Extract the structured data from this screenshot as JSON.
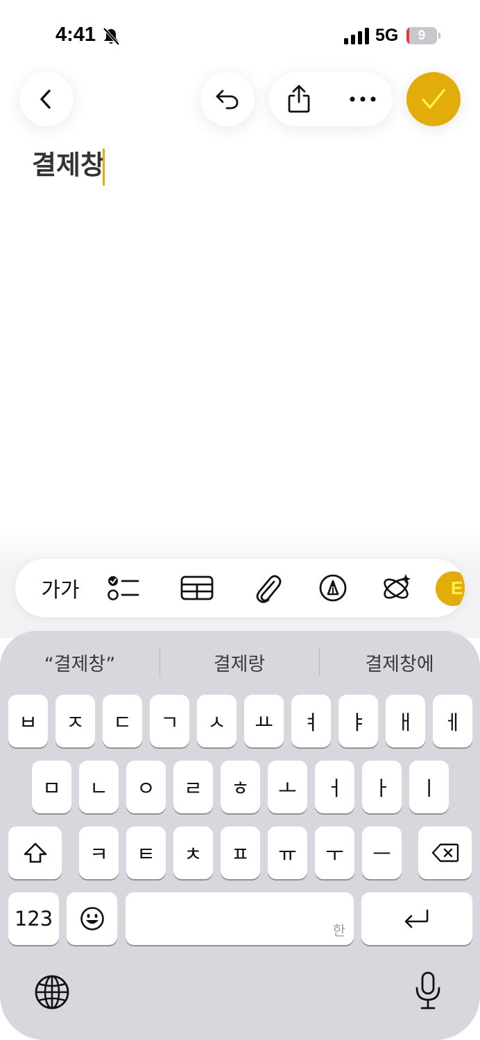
{
  "status_bar": {
    "time": "4:41",
    "network": "5G",
    "battery": "9",
    "battery_level": 0.09
  },
  "toolbar": {
    "back_icon": "chevron-left-icon",
    "undo_icon": "undo-icon",
    "share_icon": "share-icon",
    "more_icon": "ellipsis-icon",
    "done_icon": "checkmark-icon",
    "accent_color": "#e2ad0a"
  },
  "note": {
    "title": "결제창"
  },
  "format_bar": {
    "text_style_label": "가가",
    "items": [
      "checklist-icon",
      "table-icon",
      "paperclip-icon",
      "markup-pen-icon",
      "ai-sparkle-icon"
    ]
  },
  "keyboard": {
    "suggestions": [
      "“결제창”",
      "결제랑",
      "결제창에"
    ],
    "row1": [
      "ㅂ",
      "ㅈ",
      "ㄷ",
      "ㄱ",
      "ㅅ",
      "ㅛ",
      "ㅕ",
      "ㅑ",
      "ㅐ",
      "ㅔ"
    ],
    "row2": [
      "ㅁ",
      "ㄴ",
      "ㅇ",
      "ㄹ",
      "ㅎ",
      "ㅗ",
      "ㅓ",
      "ㅏ",
      "ㅣ"
    ],
    "row3": [
      "ㅋ",
      "ㅌ",
      "ㅊ",
      "ㅍ",
      "ㅠ",
      "ㅜ",
      "ㅡ"
    ],
    "numbers_label": "123",
    "space_hint": "한"
  }
}
